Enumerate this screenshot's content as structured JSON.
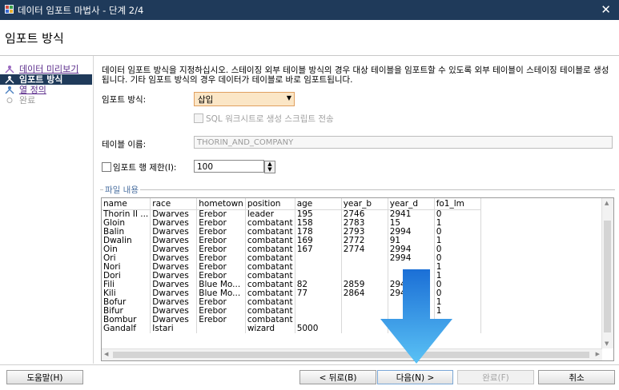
{
  "window": {
    "title": "데이터 임포트 마법사 - 단계 2/4",
    "close_glyph": "✕"
  },
  "header": {
    "title": "임포트 방식"
  },
  "steps": [
    {
      "label": "데이터 미리보기",
      "state": "link"
    },
    {
      "label": "임포트 방식",
      "state": "active"
    },
    {
      "label": "열 정의",
      "state": "link"
    },
    {
      "label": "완료",
      "state": "disabled"
    }
  ],
  "main": {
    "description": "데이터 임포트 방식을 지정하십시오. 스테이징 외부 테이블 방식의 경우 대상 테이블을 임포트할 수 있도록 외부 테이블이 스테이징 테이블로 생성됩니다. 기타 임포트 방식의 경우 데이터가 테이블로 바로 임포트됩니다.",
    "import_method_label": "임포트 방식:",
    "import_method_value": "삽입",
    "sql_checkbox_label": "SQL 워크시트로 생성 스크립트 전송",
    "table_name_label": "테이블 이름:",
    "table_name_value": "THORIN_AND_COMPANY",
    "row_limit_label": "임포트 행 제한(I):",
    "row_limit_value": "100",
    "file_content_label": "파일 내용"
  },
  "grid": {
    "columns": [
      "name",
      "race",
      "hometown",
      "position",
      "age",
      "year_b",
      "year_d",
      "fo1_lm"
    ],
    "rows": [
      [
        "Thorin II ...",
        "Dwarves",
        "Erebor",
        "leader",
        "195",
        "2746",
        "2941",
        "0"
      ],
      [
        "Gloin",
        "Dwarves",
        "Erebor",
        "combatant",
        "158",
        "2783",
        "15",
        "1"
      ],
      [
        "Balin",
        "Dwarves",
        "Erebor",
        "combatant",
        "178",
        "2793",
        "2994",
        "0"
      ],
      [
        "Dwalin",
        "Dwarves",
        "Erebor",
        "combatant",
        "169",
        "2772",
        "91",
        "1"
      ],
      [
        "Oin",
        "Dwarves",
        "Erebor",
        "combatant",
        "167",
        "2774",
        "2994",
        "0"
      ],
      [
        "Ori",
        "Dwarves",
        "Erebor",
        "combatant",
        "",
        "",
        "2994",
        "0"
      ],
      [
        "Nori",
        "Dwarves",
        "Erebor",
        "combatant",
        "",
        "",
        "",
        "1"
      ],
      [
        "Dori",
        "Dwarves",
        "Erebor",
        "combatant",
        "",
        "",
        "",
        "1"
      ],
      [
        "Fili",
        "Dwarves",
        "Blue Mo...",
        "combatant",
        "82",
        "2859",
        "2941",
        "0"
      ],
      [
        "Kili",
        "Dwarves",
        "Blue Mo...",
        "combatant",
        "77",
        "2864",
        "2941",
        "0"
      ],
      [
        "Bofur",
        "Dwarves",
        "Erebor",
        "combatant",
        "",
        "",
        "",
        "1"
      ],
      [
        "Bifur",
        "Dwarves",
        "Erebor",
        "combatant",
        "",
        "",
        "",
        "1"
      ],
      [
        "Bombur",
        "Dwarves",
        "Erebor",
        "combatant",
        "",
        "",
        "",
        ""
      ],
      [
        "Gandalf",
        "Istari",
        "",
        "wizard",
        "5000",
        "",
        "",
        ""
      ]
    ]
  },
  "footer": {
    "help": "도움말(H)",
    "back": "< 뒤로(B)",
    "next": "다음(N) >",
    "finish": "완료(F)",
    "cancel": "취소"
  },
  "colors": {
    "titlebar": "#1f3a5a",
    "combo_bg": "#fbe6c6",
    "arrow": "#3fa0e8"
  }
}
